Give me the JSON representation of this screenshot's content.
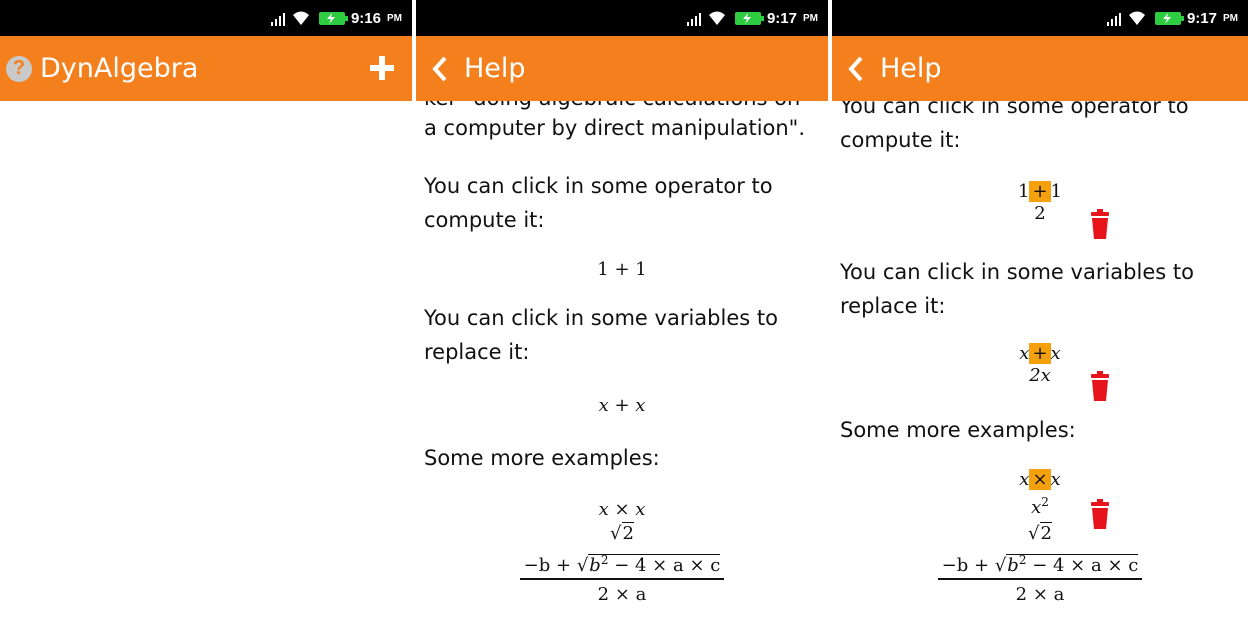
{
  "status": {
    "time1": "9:16",
    "time2": "9:17",
    "time3": "9:17",
    "ampm": "PM"
  },
  "panel1": {
    "title": "DynAlgebra",
    "help_icon": "question-icon",
    "add_icon": "plus-icon"
  },
  "panel2": {
    "title": "Help",
    "partial_line": "ker \"doing algebraic calculations on",
    "line_a": "a computer by direct manipulation\".",
    "p1": "You can click in some operator to compute it:",
    "p2": "You can click in some variables to replace it:",
    "p3": "Some more examples:"
  },
  "panel3": {
    "title": "Help",
    "p1a": "You can click in some operator to",
    "p1b": "compute it:",
    "p2a": "You can click in some variables to",
    "p2b": "replace it:",
    "p3": "Some more examples:"
  },
  "math": {
    "one": "1",
    "two": "2",
    "plus": "+",
    "times": "×",
    "x": "x",
    "two_x": "2x",
    "x_sq": "x",
    "sq_exp": "2",
    "sqrt2": "2",
    "minus_b": "−b +",
    "b": "b",
    "rest": "− 4 × a × c",
    "den": "2 × a"
  },
  "colors": {
    "appbar": "#f4801d",
    "highlight": "#f5a10d",
    "trash": "#e8141c"
  }
}
